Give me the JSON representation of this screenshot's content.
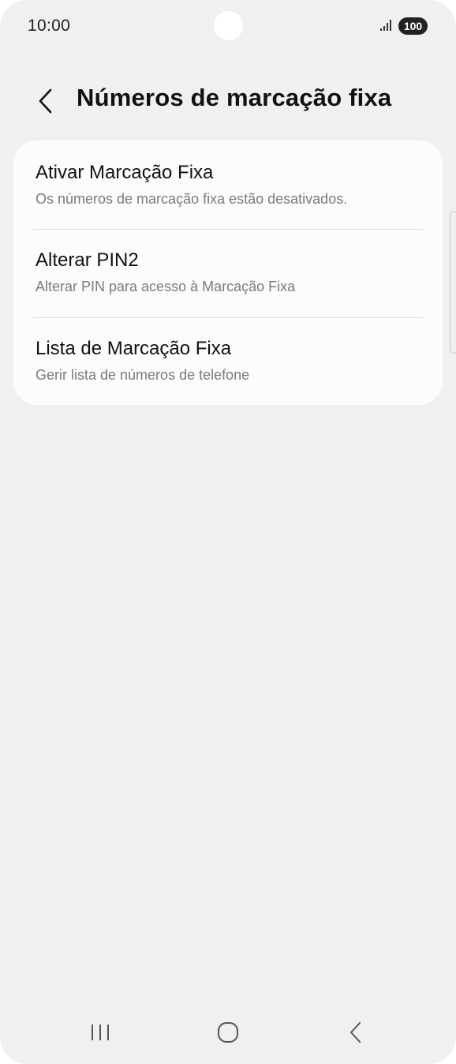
{
  "status_bar": {
    "time": "10:00",
    "battery": "100",
    "icons": [
      "signal-icon",
      "battery-icon"
    ]
  },
  "header": {
    "title": "Números de marcação fixa",
    "back_icon": "chevron-left-icon"
  },
  "settings": {
    "items": [
      {
        "title": "Ativar Marcação Fixa",
        "subtitle": "Os números de marcação fixa estão desativados."
      },
      {
        "title": "Alterar PIN2",
        "subtitle": "Alterar PIN para acesso à Marcação Fixa"
      },
      {
        "title": "Lista de Marcação Fixa",
        "subtitle": "Gerir lista de números de telefone"
      }
    ]
  },
  "nav_bar": {
    "icons": [
      "recent-apps-icon",
      "home-icon",
      "back-icon"
    ]
  },
  "colors": {
    "background": "#f0f0f2",
    "card": "#fcfcfd",
    "text_primary": "#111111",
    "text_secondary": "#7a7a7a"
  }
}
